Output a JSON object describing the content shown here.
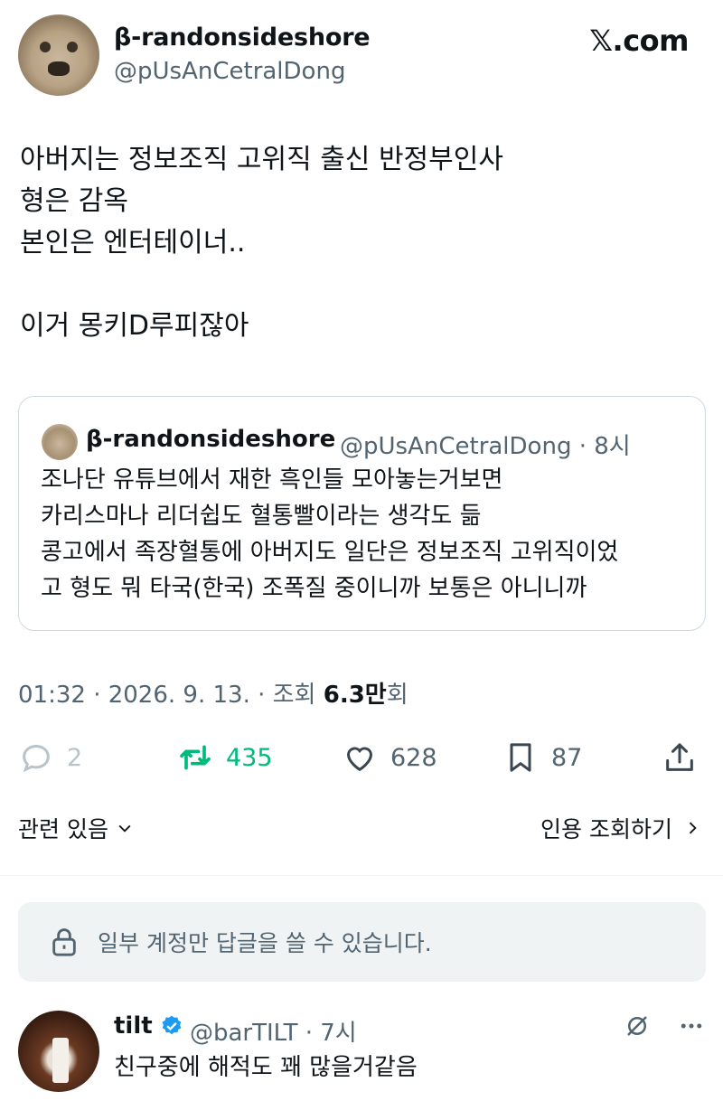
{
  "author": {
    "display_name": "β-randonsideshore",
    "handle": "@pUsAnCetralDong"
  },
  "brand": {
    "logo_text": "𝕏.com"
  },
  "tweet": {
    "text": "아버지는 정보조직 고위직 출신 반정부인사\n형은 감옥\n본인은 엔터테이너..\n\n이거 몽키D루피잖아"
  },
  "quoted_tweet": {
    "display_name": "β-randonsideshore",
    "meta": "@pUsAnCetralDong · 8시",
    "text": "조나단 유튜브에서 재한 흑인들 모아놓는거보면\n카리스마나 리더쉽도 혈통빨이라는 생각도 듦\n콩고에서 족장혈통에 아버지도 일단은 정보조직 고위직이었\n고 형도 뭐 타국(한국) 조폭질 중이니까 보통은 아니니까"
  },
  "timestamp": {
    "prefix": "01:32 · 2026. 9. 13. · 조회 ",
    "views": "6.3만",
    "suffix": "회"
  },
  "actions": {
    "replies": "2",
    "retweets": "435",
    "likes": "628",
    "bookmarks": "87"
  },
  "related": {
    "label": "관련 있음"
  },
  "quote_views": {
    "label": "인용 조회하기"
  },
  "restricted_notice": {
    "text": "일부 계정만 답글을 쓸 수 있습니다."
  },
  "reply": {
    "display_name": "tilt",
    "meta": "@barTILT · 7시",
    "text": "친구중에 해적도 꽤 많을거같음"
  },
  "colors": {
    "accent_green": "#00ba7c",
    "verified_blue": "#1d9bf0",
    "secondary_text": "#536471"
  }
}
